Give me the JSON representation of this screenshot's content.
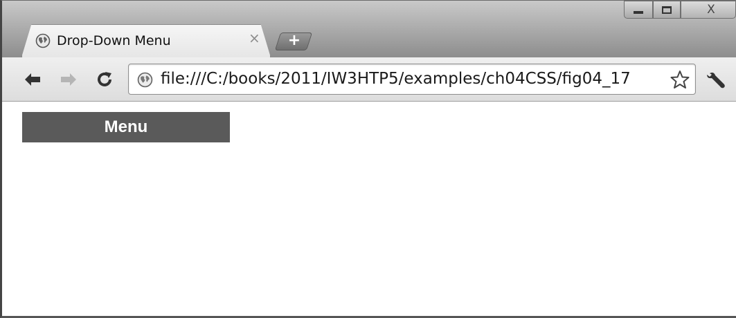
{
  "browser": {
    "tab": {
      "title": "Drop-Down Menu",
      "close_symbol": "×",
      "icon": "globe-icon"
    },
    "new_tab_symbol": "+",
    "window_controls": {
      "minimize_icon": "minimize-icon",
      "maximize_icon": "maximize-icon",
      "close_symbol": "X"
    },
    "toolbar": {
      "back_icon": "back-arrow-icon",
      "forward_icon": "forward-arrow-icon",
      "reload_icon": "reload-icon",
      "address": "file:///C:/books/2011/IW3HTP5/examples/ch04CSS/fig04_17",
      "bookmark_icon": "star-icon",
      "settings_icon": "wrench-icon"
    }
  },
  "page": {
    "menu_label": "Menu"
  },
  "colors": {
    "menu_background": "#5a5a5a",
    "menu_text": "#ffffff",
    "page_background": "#ffffff"
  }
}
